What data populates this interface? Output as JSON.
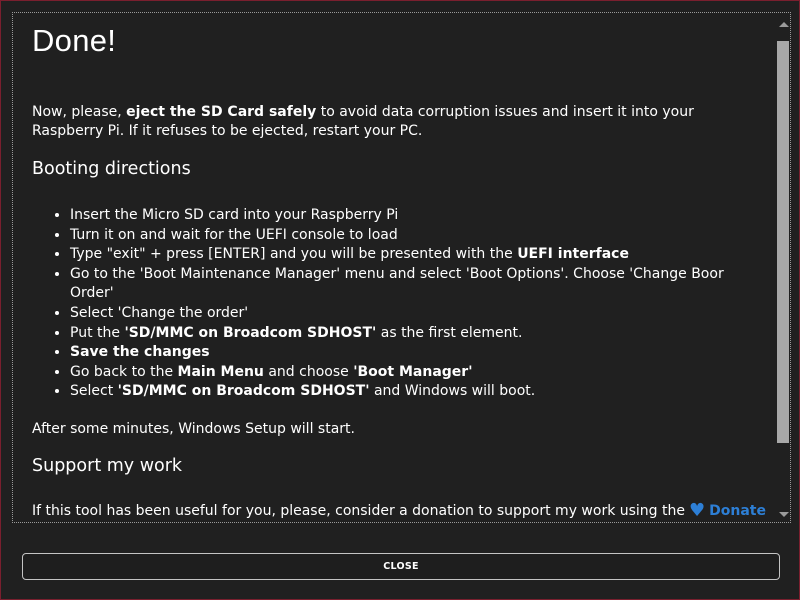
{
  "dialog": {
    "title": "Done!",
    "intro": {
      "part1": "Now, please, ",
      "bold": "eject the SD Card safely",
      "part2": " to avoid data corruption issues and insert it into your Raspberry Pi. If it refuses to be ejected, restart your PC."
    },
    "booting_title": "Booting directions",
    "steps": [
      {
        "pre": "Insert the Micro SD card into your Raspberry Pi"
      },
      {
        "pre": "Turn it on and wait for the UEFI console to load"
      },
      {
        "pre": "Type \"exit\" + press [ENTER] and you will be presented with the ",
        "bold": "UEFI interface"
      },
      {
        "pre": "Go to the 'Boot Maintenance Manager' menu and select 'Boot Options'. Choose 'Change Boor Order'"
      },
      {
        "pre": "Select 'Change the order'"
      },
      {
        "pre": "Put the ",
        "bold": "'SD/MMC on Broadcom SDHOST'",
        "post": " as the first element."
      },
      {
        "bold": "Save the changes"
      },
      {
        "pre": "Go back to the ",
        "bold": "Main Menu",
        "mid": " and choose ",
        "bold2": "'Boot Manager'"
      },
      {
        "pre": "Select ",
        "bold": "'SD/MMC on Broadcom SDHOST'",
        "post": " and Windows will boot."
      }
    ],
    "after_text": "After some minutes, Windows Setup will start.",
    "support_title": "Support my work",
    "support_text": "If this tool has been useful for you, please, consider a donation to support my work using the",
    "donate_label": "Donate",
    "heart_icon": "heart-icon",
    "close_label": "CLOSE"
  },
  "colors": {
    "background": "#202020",
    "accent_link": "#2d7fd6",
    "window_border": "#7a1f2e"
  }
}
